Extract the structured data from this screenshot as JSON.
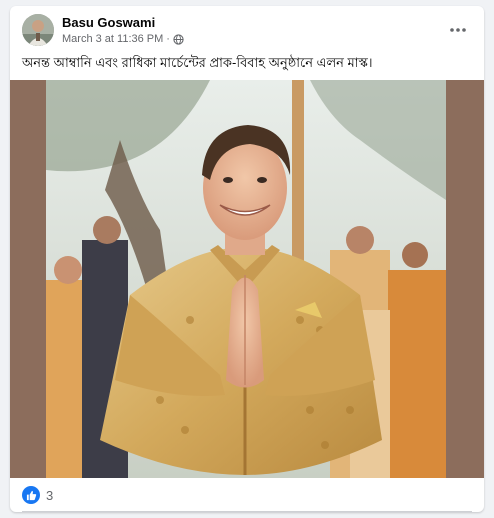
{
  "post": {
    "author": "Basu Goswami",
    "timestamp": "March 3 at 11:36 PM",
    "separator": "·",
    "privacy_icon": "globe-icon",
    "more_icon": "more-horizontal-icon",
    "caption": "অনন্ত আম্বানি এবং রাধিকা মার্চেন্টের প্রাক-বিবাহ অনুষ্ঠানে এলন মাস্ক।",
    "reactions": {
      "icon": "like-icon",
      "count": "3"
    }
  },
  "colors": {
    "like_blue": "#1877f2",
    "frame_brown": "#8c6d5c",
    "text_primary": "#050505",
    "text_secondary": "#65676b",
    "sherwani_gold": "#d8b368"
  }
}
